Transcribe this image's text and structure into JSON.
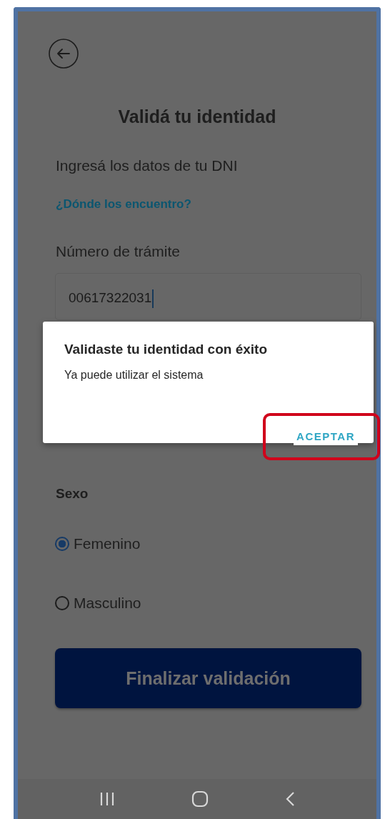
{
  "screen": {
    "title": "Validá tu identidad",
    "intro": "Ingresá los datos de tu DNI",
    "help_link": "¿Dónde los encuentro?",
    "field": {
      "label": "Número de trámite",
      "value": "00617322031"
    },
    "sex": {
      "label": "Sexo",
      "options": [
        {
          "label": "Femenino",
          "selected": true
        },
        {
          "label": "Masculino",
          "selected": false
        }
      ]
    },
    "submit": "Finalizar validación"
  },
  "dialog": {
    "title": "Validaste tu identidad con éxito",
    "message": "Ya puede utilizar el sistema",
    "button": "ACEPTAR",
    "highlighted": true
  }
}
